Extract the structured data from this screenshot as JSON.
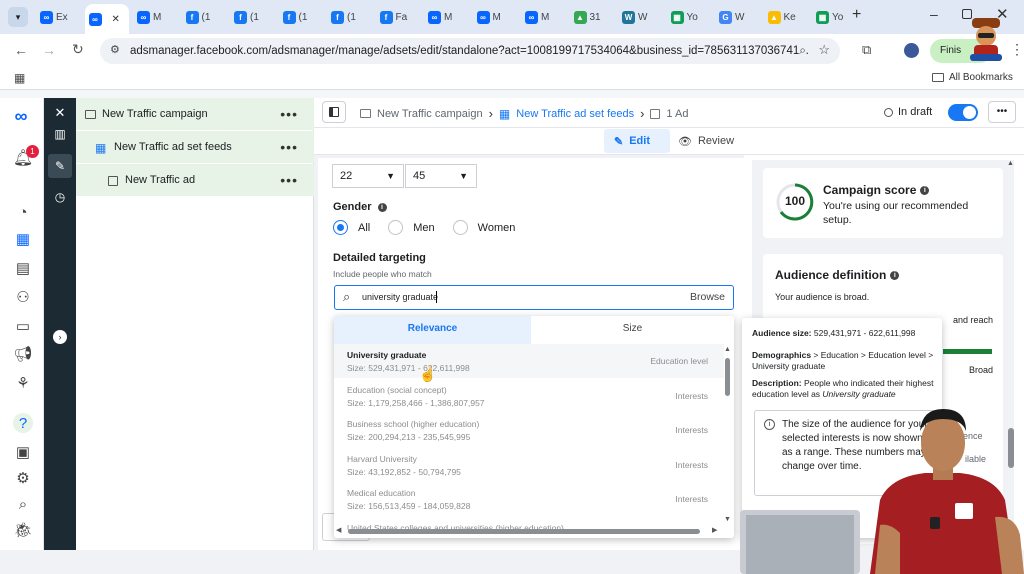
{
  "browser": {
    "tabs": [
      {
        "label": "Ex",
        "icon": "meta-icon"
      },
      {
        "label": "",
        "icon": "meta-icon",
        "active": true
      },
      {
        "label": "M",
        "icon": "meta-icon"
      },
      {
        "label": "(1",
        "icon": "facebook-icon"
      },
      {
        "label": "(1",
        "icon": "facebook-icon"
      },
      {
        "label": "(1",
        "icon": "facebook-icon"
      },
      {
        "label": "(1",
        "icon": "facebook-icon"
      },
      {
        "label": "Fa",
        "icon": "facebook-icon"
      },
      {
        "label": "M",
        "icon": "meta-icon"
      },
      {
        "label": "M",
        "icon": "meta-icon"
      },
      {
        "label": "M",
        "icon": "meta-icon"
      },
      {
        "label": "31",
        "icon": "drive-icon"
      },
      {
        "label": "W",
        "icon": "wordpress-icon"
      },
      {
        "label": "Yo",
        "icon": "sheets-icon"
      },
      {
        "label": "W",
        "icon": "google-icon"
      },
      {
        "label": "Ke",
        "icon": "ads-icon"
      },
      {
        "label": "Yo",
        "icon": "sheets-icon"
      }
    ],
    "url": "adsmanager.facebook.com/adsmanager/manage/adsets/edit/standalone?act=1008199717534064&business_id=785631137036741...",
    "profile_button": "Finis",
    "all_bookmarks": "All Bookmarks"
  },
  "rail": {
    "notification_count": "1"
  },
  "tree": {
    "campaign": "New Traffic campaign",
    "adset": "New Traffic ad set feeds",
    "ad": "New Traffic ad",
    "more": "•••"
  },
  "topnav": {
    "crumb_campaign": "New Traffic campaign",
    "crumb_adset": "New Traffic ad set feeds",
    "crumb_ad": "1 Ad",
    "status": "In draft",
    "more": "•••",
    "sep": "›"
  },
  "subnav": {
    "edit": "Edit",
    "review": "Review"
  },
  "form": {
    "age_min": "22",
    "age_max": "45",
    "gender_label": "Gender",
    "gender_options": [
      "All",
      "Men",
      "Women"
    ],
    "detailed_targeting_label": "Detailed targeting",
    "detailed_targeting_sub": "Include people who match",
    "search_value": "university graduate",
    "browse": "Browse",
    "tab_relevance": "Relevance",
    "tab_size": "Size"
  },
  "suggestions": [
    {
      "name": "University graduate",
      "size": "Size: 529,431,971 - 622,611,998",
      "type": "Education level"
    },
    {
      "name": "Education (social concept)",
      "size": "Size: 1,179,258,466 - 1,386,807,957",
      "type": "Interests"
    },
    {
      "name": "Business school (higher education)",
      "size": "Size: 200,294,213 - 235,545,995",
      "type": "Interests"
    },
    {
      "name": "Harvard University",
      "size": "Size: 43,192,852 - 50,794,795",
      "type": "Interests"
    },
    {
      "name": "Medical education",
      "size": "Size: 156,513,459 - 184,059,828",
      "type": "Interests"
    },
    {
      "name": "United States colleges and universities (higher education)",
      "size": "",
      "type": ""
    }
  ],
  "tooltip": {
    "audience_size_label": "Audience size:",
    "audience_size_value": "529,431,971 - 622,611,998",
    "demographics_label": "Demographics",
    "demographics_value": "> Education > Education level > University graduate",
    "description_label": "Description:",
    "description_value": "People who indicated their highest education level as",
    "description_em": "University graduate",
    "note": "The size of the audience for your selected interests is now shown as a range. These numbers may change over time."
  },
  "right": {
    "score": "100",
    "score_title": "Campaign score",
    "score_sub": "You're using our recommended setup.",
    "audience_title": "Audience definition",
    "audience_sub": "Your audience is broad.",
    "and_reach": "and reach",
    "broad": "Broad",
    "ience": "ience",
    "ilable": "ilable"
  },
  "colors": {
    "accent": "#1877f2",
    "dark_rail": "#1c2b33",
    "selected_row": "#e7f3e7"
  }
}
